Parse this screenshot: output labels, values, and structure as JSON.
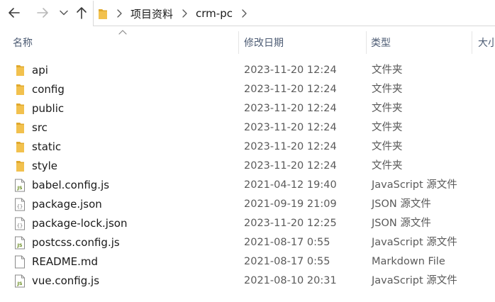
{
  "breadcrumb": {
    "items": [
      "项目资料",
      "crm-pc"
    ]
  },
  "columns": {
    "name": "名称",
    "modified": "修改日期",
    "type": "类型",
    "size": "大小"
  },
  "files": [
    {
      "name": "api",
      "date": "2023-11-20 12:24",
      "type": "文件夹",
      "icon": "folder-icon"
    },
    {
      "name": "config",
      "date": "2023-11-20 12:24",
      "type": "文件夹",
      "icon": "folder-icon"
    },
    {
      "name": "public",
      "date": "2023-11-20 12:24",
      "type": "文件夹",
      "icon": "folder-icon"
    },
    {
      "name": "src",
      "date": "2023-11-20 12:24",
      "type": "文件夹",
      "icon": "folder-icon"
    },
    {
      "name": "static",
      "date": "2023-11-20 12:24",
      "type": "文件夹",
      "icon": "folder-icon"
    },
    {
      "name": "style",
      "date": "2023-11-20 12:24",
      "type": "文件夹",
      "icon": "folder-icon"
    },
    {
      "name": "babel.config.js",
      "date": "2021-04-12 19:40",
      "type": "JavaScript 源文件",
      "icon": "js-file-icon"
    },
    {
      "name": "package.json",
      "date": "2021-09-19 21:09",
      "type": "JSON 源文件",
      "icon": "json-file-icon"
    },
    {
      "name": "package-lock.json",
      "date": "2023-11-20 12:25",
      "type": "JSON 源文件",
      "icon": "json-file-icon"
    },
    {
      "name": "postcss.config.js",
      "date": "2021-08-17 0:55",
      "type": "JavaScript 源文件",
      "icon": "js-file-icon"
    },
    {
      "name": "README.md",
      "date": "2021-08-17 0:55",
      "type": "Markdown File",
      "icon": "md-file-icon"
    },
    {
      "name": "vue.config.js",
      "date": "2021-08-10 20:31",
      "type": "JavaScript 源文件",
      "icon": "js-file-icon"
    }
  ],
  "colors": {
    "folder": "#f2c14e",
    "header_text": "#4c5b73",
    "meta_text": "#5a5a5a"
  }
}
